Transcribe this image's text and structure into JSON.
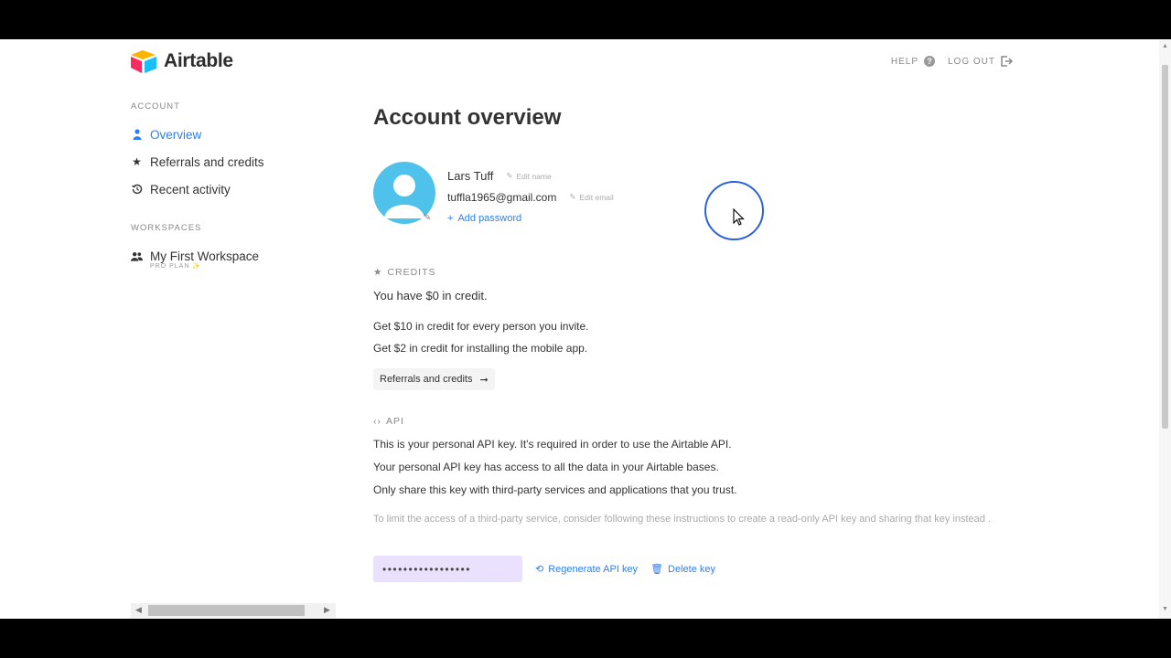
{
  "brand": {
    "name": "Airtable"
  },
  "topnav": {
    "help": "HELP",
    "logout": "LOG OUT"
  },
  "sidebar": {
    "account_label": "ACCOUNT",
    "items": [
      {
        "label": "Overview",
        "icon": "user-icon",
        "active": true
      },
      {
        "label": "Referrals and credits",
        "icon": "star-icon"
      },
      {
        "label": "Recent activity",
        "icon": "history-icon"
      }
    ],
    "workspaces_label": "WORKSPACES",
    "workspace": {
      "label": "My First Workspace",
      "plan": "PRO PLAN ✨",
      "icon": "people-icon"
    }
  },
  "main": {
    "title": "Account overview",
    "profile": {
      "name": "Lars Tuff",
      "edit_name": "Edit name",
      "email": "tuffla1965@gmail.com",
      "edit_email": "Edit email",
      "add_password": "Add password"
    },
    "credits": {
      "heading": "CREDITS",
      "balance": "You have $0 in credit.",
      "invite": "Get $10 in credit for every person you invite.",
      "mobile": "Get $2 in credit for installing the mobile app.",
      "button": "Referrals and credits"
    },
    "api": {
      "heading": "API",
      "line1": "This is your personal API key. It's required in order to use the Airtable API.",
      "line2": "Your personal API key has access to all the data in your Airtable bases.",
      "line3": "Only share this key with third-party services and applications that you trust.",
      "note": "To limit the access of a third-party service, consider following these instructions to create a read-only API key and sharing that key instead .",
      "key_masked": "•••••••••••••••••",
      "regenerate": "Regenerate API key",
      "delete": "Delete key"
    }
  },
  "colors": {
    "accent": "#2d7ff9",
    "api_key_bg": "#e9e1fd",
    "avatar": "#4fc2ec"
  }
}
